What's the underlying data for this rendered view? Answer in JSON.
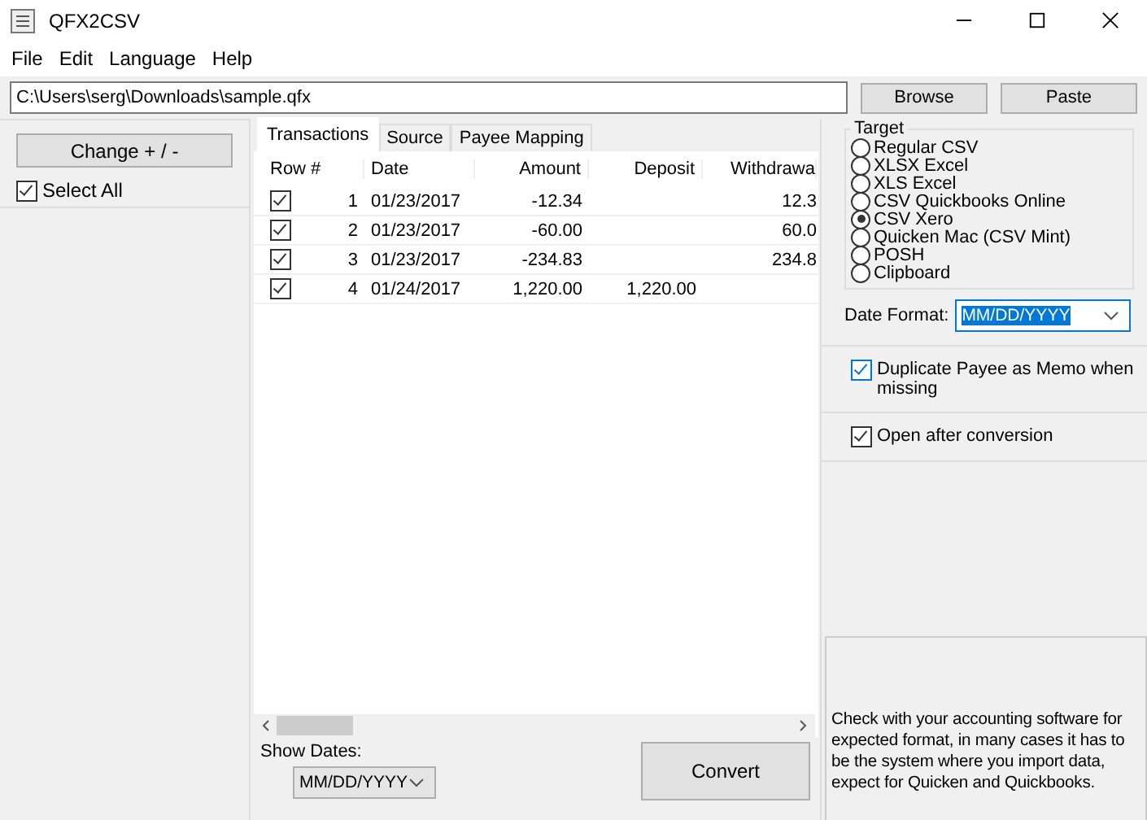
{
  "window": {
    "title": "QFX2CSV"
  },
  "menu": [
    "File",
    "Edit",
    "Language",
    "Help"
  ],
  "path": {
    "value": "C:\\Users\\serg\\Downloads\\sample.qfx"
  },
  "path_buttons": [
    "Browse",
    "Paste"
  ],
  "left": {
    "change_button": "Change + / -",
    "select_all": {
      "label": "Select All",
      "checked": true
    }
  },
  "tabs": [
    {
      "label": "Transactions",
      "selected": true
    },
    {
      "label": "Source",
      "selected": false
    },
    {
      "label": "Payee Mapping",
      "selected": false
    }
  ],
  "table": {
    "columns": [
      "Row #",
      "Date",
      "Amount",
      "Deposit",
      "Withdrawa"
    ],
    "rows": [
      {
        "checked": true,
        "cells": [
          "1",
          "01/23/2017",
          "-12.34",
          "",
          "12.3"
        ]
      },
      {
        "checked": true,
        "cells": [
          "2",
          "01/23/2017",
          "-60.00",
          "",
          "60.0"
        ]
      },
      {
        "checked": true,
        "cells": [
          "3",
          "01/23/2017",
          "-234.83",
          "",
          "234.8"
        ]
      },
      {
        "checked": true,
        "cells": [
          "4",
          "01/24/2017",
          "1,220.00",
          "1,220.00",
          ""
        ]
      }
    ]
  },
  "show_dates": {
    "label": "Show Dates:",
    "value": "MM/DD/YYYY"
  },
  "convert_button": "Convert",
  "target": {
    "title": "Target",
    "options": [
      {
        "label": "Regular CSV",
        "selected": false
      },
      {
        "label": "XLSX Excel",
        "selected": false
      },
      {
        "label": "XLS Excel",
        "selected": false
      },
      {
        "label": "CSV Quickbooks Online",
        "selected": false
      },
      {
        "label": "CSV Xero",
        "selected": true
      },
      {
        "label": "Quicken Mac (CSV Mint)",
        "selected": false
      },
      {
        "label": "POSH",
        "selected": false
      },
      {
        "label": "Clipboard",
        "selected": false
      }
    ]
  },
  "date_format": {
    "label": "Date Format:",
    "value": "MM/DD/YYYY"
  },
  "options": [
    {
      "label": "Duplicate Payee as Memo when missing",
      "checked": true
    },
    {
      "label": "Open after conversion",
      "checked": true
    }
  ],
  "info": "Check with your accounting software for expected format, in many cases it has to be the system where you import data, expect for Quicken and Quickbooks."
}
